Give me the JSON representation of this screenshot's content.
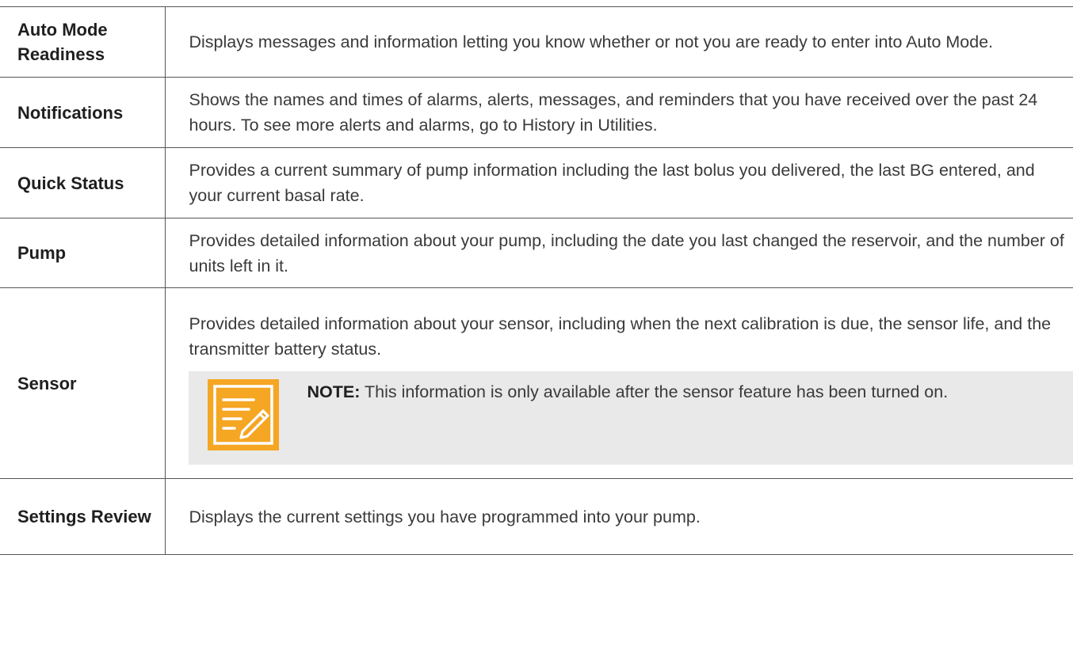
{
  "rows": [
    {
      "term": "Auto Mode Readiness",
      "description": "Displays messages and information letting you know whether or not you are ready to enter into Auto Mode."
    },
    {
      "term": "Notifications",
      "description": "Shows the names and times of alarms, alerts, messages, and reminders that you have received over the past 24 hours. To see more alerts and alarms, go to History in Utilities."
    },
    {
      "term": "Quick Status",
      "description": "Provides a current summary of pump information including the last bolus you delivered, the last BG entered, and your current basal rate."
    },
    {
      "term": "Pump",
      "description": "Provides detailed information about your pump, including the date you last changed the reservoir, and the number of units left in it."
    },
    {
      "term": "Sensor",
      "description": "Provides detailed information about your sensor, including when the next calibration is due, the sensor life, and the transmitter battery status.",
      "note": {
        "label": "NOTE:",
        "text": " This information is only available after the sensor feature has been turned on.",
        "icon": "note-pencil-icon",
        "icon_color": "#f5a623"
      }
    },
    {
      "term": "Settings Review",
      "description": "Displays the current settings you have programmed into your pump."
    }
  ]
}
